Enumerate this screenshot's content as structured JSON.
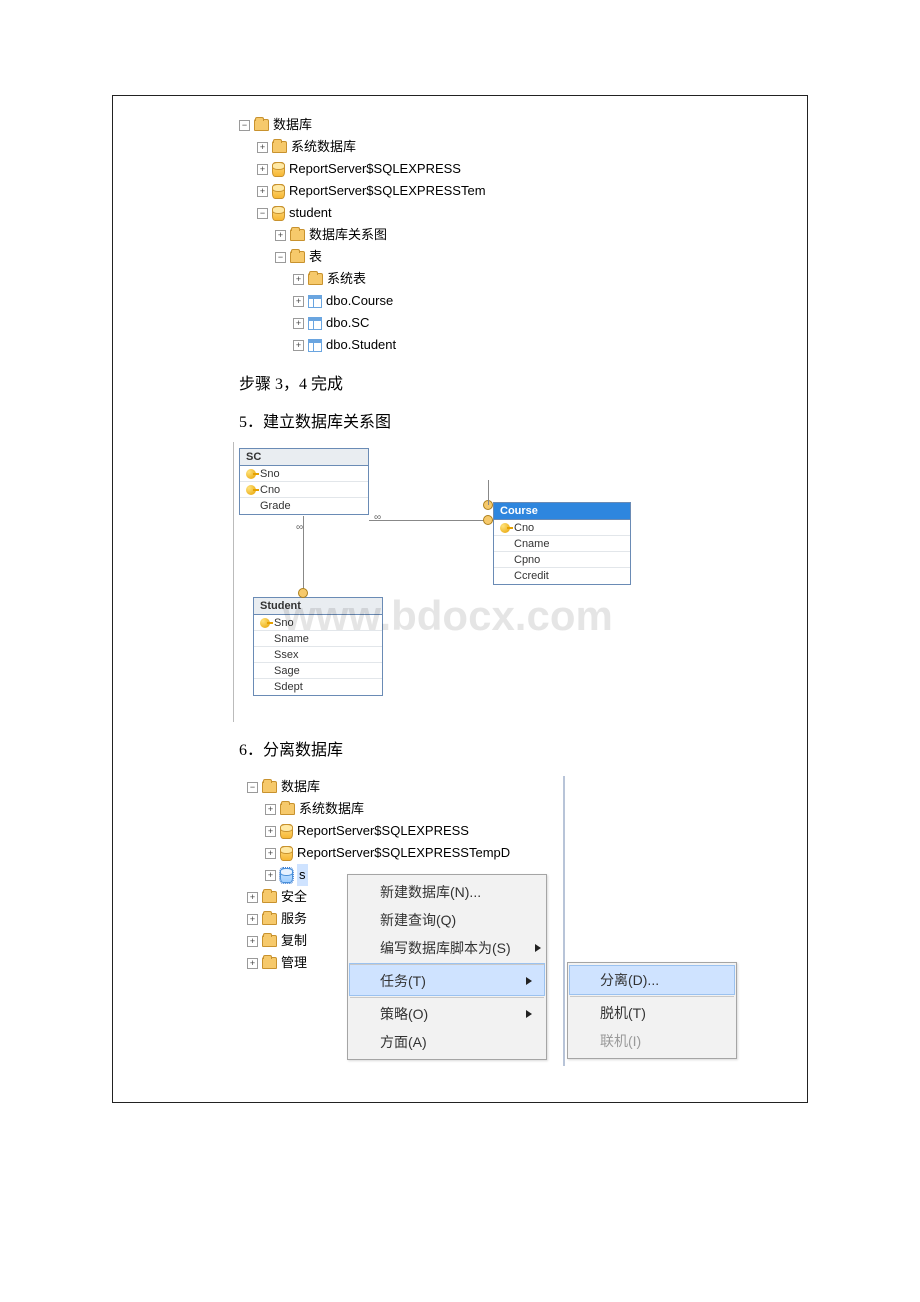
{
  "tree1": {
    "root": "数据库",
    "sysdb": "系统数据库",
    "rs1": "ReportServer$SQLEXPRESS",
    "rs2": "ReportServer$SQLEXPRESSTem",
    "student": "student",
    "diagram_folder": "数据库关系图",
    "tables_folder": "表",
    "systables": "系统表",
    "t_course": "dbo.Course",
    "t_sc": "dbo.SC",
    "t_student": "dbo.Student"
  },
  "steps": {
    "s34": "步骤 3，4 完成",
    "s5": "5．建立数据库关系图",
    "s6": "6．分离数据库"
  },
  "diagram": {
    "sc": {
      "title": "SC",
      "cols": [
        "Sno",
        "Cno",
        "Grade"
      ]
    },
    "course": {
      "title": "Course",
      "cols": [
        "Cno",
        "Cname",
        "Cpno",
        "Ccredit"
      ]
    },
    "student": {
      "title": "Student",
      "cols": [
        "Sno",
        "Sname",
        "Ssex",
        "Sage",
        "Sdept"
      ]
    }
  },
  "watermark": "www.bdocx.com",
  "tree2": {
    "root": "数据库",
    "sysdb": "系统数据库",
    "rs1": "ReportServer$SQLEXPRESS",
    "rs2": "ReportServer$SQLEXPRESSTempD",
    "selected_db_initial": "s",
    "security": "安全",
    "server": "服务",
    "replication": "复制",
    "management": "管理"
  },
  "menu": {
    "new_db": "新建数据库(N)...",
    "new_query": "新建查询(Q)",
    "script": "编写数据库脚本为(S)",
    "tasks": "任务(T)",
    "policies": "策略(O)",
    "facets": "方面(A)"
  },
  "submenu": {
    "detach": "分离(D)...",
    "offline": "脱机(T)",
    "online": "联机(I)"
  }
}
